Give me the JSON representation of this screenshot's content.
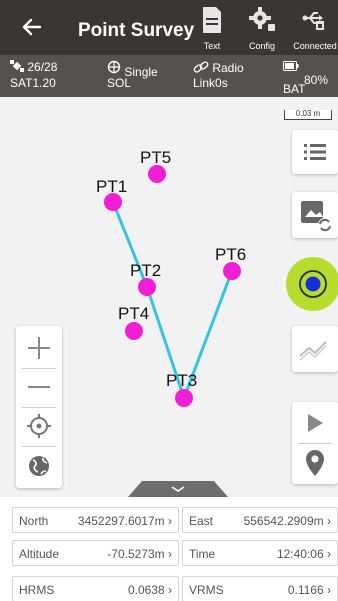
{
  "header": {
    "title": "Point Survey",
    "buttons": [
      {
        "label": "Text",
        "icon": "document-icon"
      },
      {
        "label": "Config",
        "icon": "gear-icon"
      },
      {
        "label": "Connected",
        "icon": "usb-icon"
      }
    ]
  },
  "status": {
    "sat_count": "26/28",
    "sat_label": "SAT",
    "sat_value": "1.20",
    "sol_status": "Single",
    "sol_label": "SOL",
    "radio_label": "Radio",
    "link_label": "Link",
    "link_value": "0s",
    "battery_label": "BAT",
    "battery_value": "80%"
  },
  "map": {
    "scale_label": "0.03 m",
    "line_color": "#33c3e3",
    "point_color": "#f01fd6",
    "points": [
      {
        "name": "PT1"
      },
      {
        "name": "PT2"
      },
      {
        "name": "PT3"
      },
      {
        "name": "PT4"
      },
      {
        "name": "PT5"
      },
      {
        "name": "PT6"
      }
    ]
  },
  "readouts": [
    {
      "label": "North",
      "value": "3452297.6017m"
    },
    {
      "label": "East",
      "value": "556542.2909m"
    },
    {
      "label": "Altitude",
      "value": "-70.5273m"
    },
    {
      "label": "Time",
      "value": "12:40:06"
    },
    {
      "label": "HRMS",
      "value": "0.0638"
    },
    {
      "label": "VRMS",
      "value": "0.1166"
    }
  ],
  "colors": {
    "topbar": "#3a3733",
    "statusbar": "#55524e",
    "record_ring": "#b8dc2e",
    "record_dot": "#1530d8"
  }
}
